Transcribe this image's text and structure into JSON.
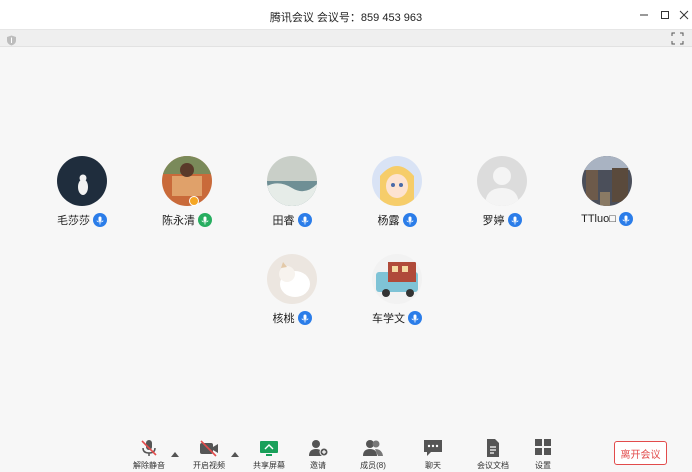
{
  "window": {
    "title": "腾讯会议 会议号：859 453 963",
    "controls": [
      "minimize-icon",
      "maximize-icon",
      "close-icon"
    ]
  },
  "subbar": {
    "icons": [
      "shield-icon",
      "fullscreen-icon"
    ]
  },
  "participants": [
    {
      "name": "毛莎莎",
      "mic_color": "#2b7de9",
      "avatar": "penguin-avatar"
    },
    {
      "name": "陈永清",
      "mic_color": "#27ae60",
      "avatar": "photo-avatar",
      "host": true
    },
    {
      "name": "田睿",
      "mic_color": "#2b7de9",
      "avatar": "sea-painting-avatar"
    },
    {
      "name": "杨露",
      "mic_color": "#2b7de9",
      "avatar": "anime-girl-avatar"
    },
    {
      "name": "罗婷",
      "mic_color": "#2b7de9",
      "avatar": "default-person-avatar"
    },
    {
      "name": "TTluo□",
      "mic_color": "#2b7de9",
      "avatar": "street-avatar"
    },
    {
      "name": "核桃",
      "mic_color": "#2b7de9",
      "avatar": "cat-avatar"
    },
    {
      "name": "车学文",
      "mic_color": "#2b7de9",
      "avatar": "bus-avatar"
    }
  ],
  "toolbar": {
    "unmute": "解除静音",
    "start_video": "开启视频",
    "share_screen": "共享屏幕",
    "invite": "邀请",
    "members": "成员(8)",
    "chat": "聊天",
    "docs": "会议文档",
    "settings": "设置",
    "leave": "离开会议"
  },
  "colors": {
    "accent": "#2b7de9",
    "leave": "#e24b4b",
    "share": "#1aa05a"
  }
}
